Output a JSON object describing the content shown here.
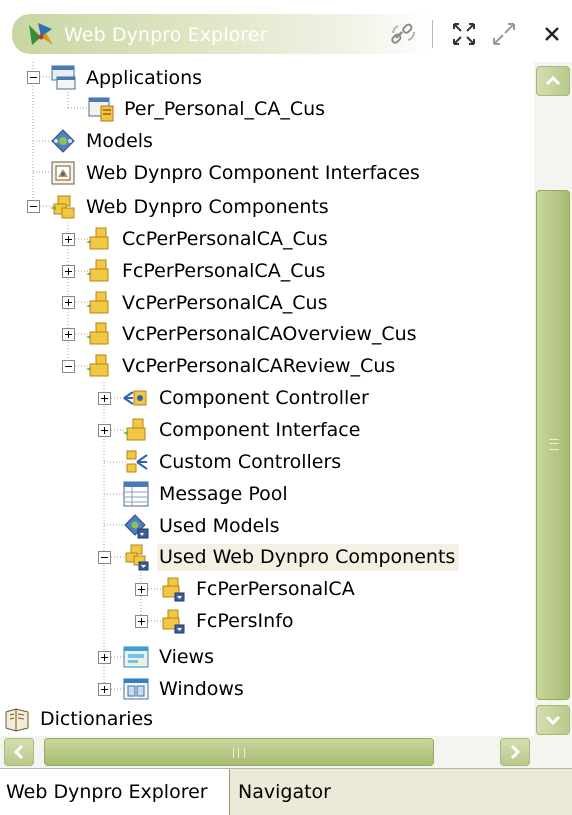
{
  "window": {
    "title": "Web Dynpro Explorer",
    "accent_color": "#b9c98b",
    "selection_color": "#f4f1e4"
  },
  "toolbar": {
    "sync_icon": "link-sync-icon",
    "maximize_icon": "maximize-icon",
    "restore_icon": "restore-icon",
    "close_label": "×"
  },
  "tree": {
    "nodes": [
      {
        "label": "Applications",
        "icon": "applications-icon",
        "expanded": true
      },
      {
        "label": "Per_Personal_CA_Cus",
        "icon": "application-icon"
      },
      {
        "label": "Models",
        "icon": "models-icon"
      },
      {
        "label": "Web Dynpro Component Interfaces",
        "icon": "component-interfaces-icon"
      },
      {
        "label": "Web Dynpro Components",
        "icon": "components-icon",
        "expanded": true
      },
      {
        "label": "CcPerPersonalCA_Cus",
        "icon": "component-icon",
        "expanded": false
      },
      {
        "label": "FcPerPersonalCA_Cus",
        "icon": "component-icon",
        "expanded": false
      },
      {
        "label": "VcPerPersonalCA_Cus",
        "icon": "component-icon",
        "expanded": false
      },
      {
        "label": "VcPerPersonalCAOverview_Cus",
        "icon": "component-icon",
        "expanded": false
      },
      {
        "label": "VcPerPersonalCAReview_Cus",
        "icon": "component-icon",
        "expanded": true
      },
      {
        "label": "Component Controller",
        "icon": "component-controller-icon",
        "expanded": false
      },
      {
        "label": "Component Interface",
        "icon": "component-interface-icon",
        "expanded": false
      },
      {
        "label": "Custom Controllers",
        "icon": "custom-controllers-icon"
      },
      {
        "label": "Message Pool",
        "icon": "message-pool-icon"
      },
      {
        "label": "Used Models",
        "icon": "used-models-icon"
      },
      {
        "label": "Used Web Dynpro Components",
        "icon": "used-components-icon",
        "expanded": true,
        "selected": true
      },
      {
        "label": "FcPerPersonalCA",
        "icon": "used-component-icon",
        "expanded": false
      },
      {
        "label": "FcPersInfo",
        "icon": "used-component-icon",
        "expanded": false
      },
      {
        "label": "Views",
        "icon": "views-icon",
        "expanded": false
      },
      {
        "label": "Windows",
        "icon": "windows-icon",
        "expanded": false
      },
      {
        "label": "Dictionaries",
        "icon": "dictionaries-icon"
      }
    ]
  },
  "tabs": {
    "active": "Web Dynpro Explorer",
    "inactive": "Navigator"
  }
}
